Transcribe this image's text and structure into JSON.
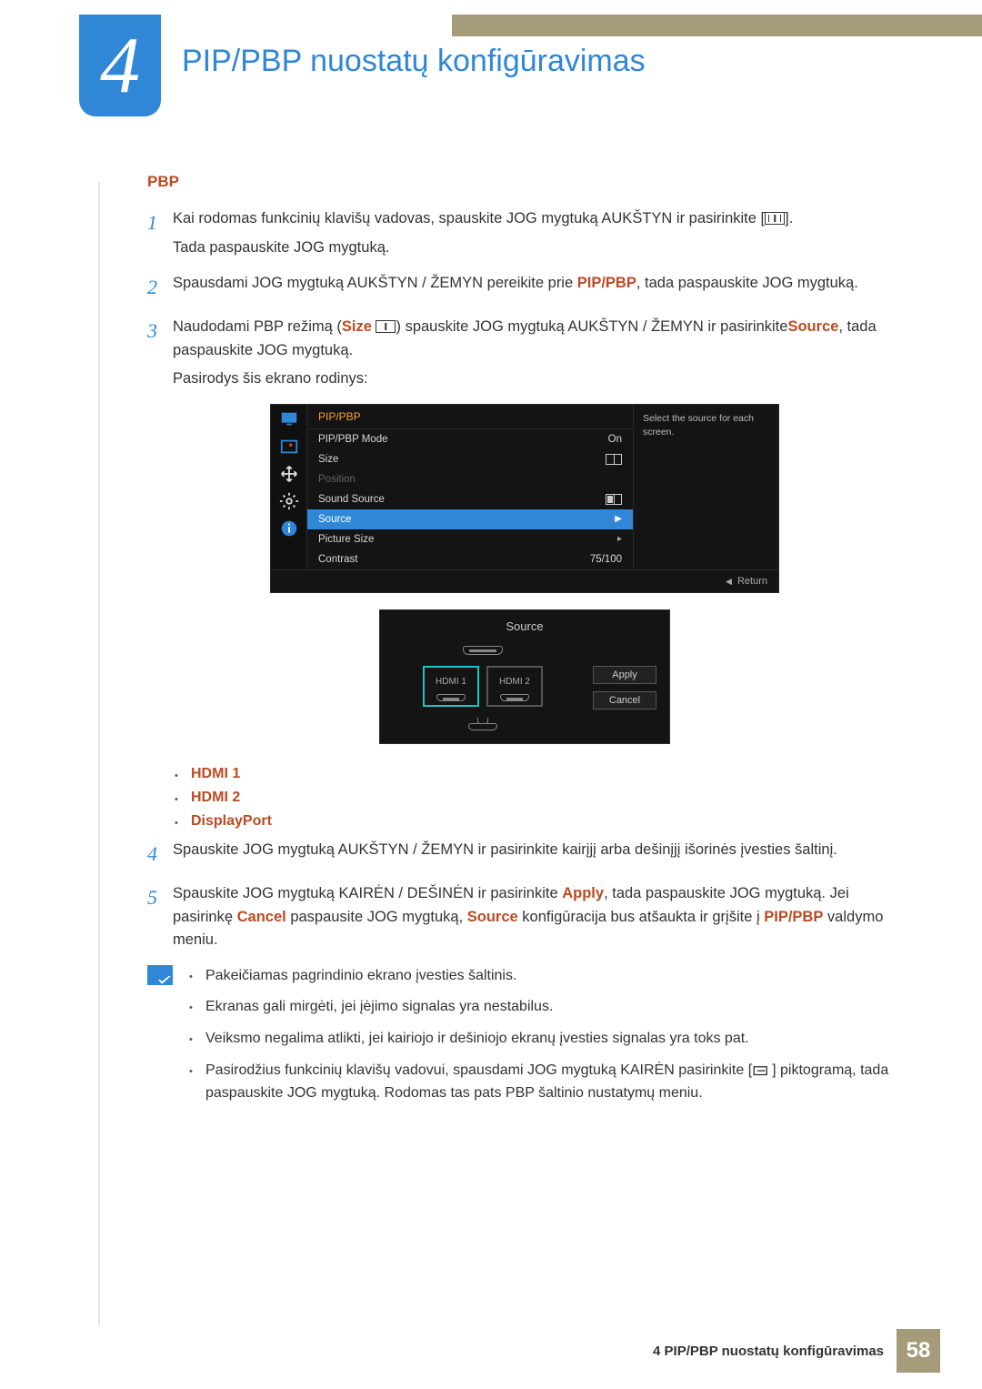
{
  "chapter": {
    "number": "4",
    "title": "PIP/PBP nuostatų konfigūravimas"
  },
  "section_label": "PBP",
  "steps": {
    "s1": {
      "n": "1",
      "a": "Kai rodomas funkcinių klavišų vadovas, spauskite JOG mygtuką AUKŠTYN ir pasirinkite [",
      "b": "].",
      "c": "Tada paspauskite JOG mygtuką."
    },
    "s2": {
      "n": "2",
      "a": "Spausdami JOG mygtuką AUKŠTYN / ŽEMYN pereikite prie ",
      "kw": "PIP/PBP",
      "b": ", tada paspauskite JOG mygtuką."
    },
    "s3": {
      "n": "3",
      "a": "Naudodami PBP režimą (",
      "kw1": "Size",
      "b": ") spauskite JOG mygtuką AUKŠTYN / ŽEMYN ir pasirinkite",
      "kw2": "Source",
      "c": ", tada paspauskite JOG mygtuką.",
      "d": "Pasirodys šis ekrano rodinys:"
    },
    "s4": {
      "n": "4",
      "a": "Spauskite JOG mygtuką AUKŠTYN / ŽEMYN ir pasirinkite kairįjį arba dešinįjį išorinės įvesties šaltinį."
    },
    "s5": {
      "n": "5",
      "a": "Spauskite JOG mygtuką KAIRĖN / DEŠINĖN ir pasirinkite ",
      "kw1": "Apply",
      "b": ", tada paspauskite JOG mygtuką. Jei pasirinkę ",
      "kw2": "Cancel",
      "c": " paspausite JOG mygtuką, ",
      "kw3": "Source",
      "d": " konfigūracija bus atšaukta ir grįšite į ",
      "kw4": "PIP/PBP",
      "e": " valdymo meniu."
    }
  },
  "osd": {
    "header": "PIP/PBP",
    "help": "Select the source for each screen.",
    "rows": {
      "mode": {
        "label": "PIP/PBP Mode",
        "value": "On"
      },
      "size": {
        "label": "Size"
      },
      "position": {
        "label": "Position"
      },
      "sound": {
        "label": "Sound Source"
      },
      "source": {
        "label": "Source"
      },
      "psize": {
        "label": "Picture Size"
      },
      "contrast": {
        "label": "Contrast",
        "value": "75/100"
      }
    },
    "return": "Return"
  },
  "src": {
    "title": "Source",
    "hdmi1": "HDMI  1",
    "hdmi2": "HDMI  2",
    "apply": "Apply",
    "cancel": "Cancel"
  },
  "redlist": {
    "a": "HDMI 1",
    "b": "HDMI 2",
    "c": "DisplayPort"
  },
  "notes": {
    "a": "Pakeičiamas pagrindinio ekrano įvesties šaltinis.",
    "b": "Ekranas gali mirgėti, jei įėjimo signalas yra nestabilus.",
    "c": "Veiksmo negalima atlikti, jei kairiojo ir dešiniojo ekranų įvesties signalas yra toks pat.",
    "d1": "Pasirodžius funkcinių klavišų vadovui, spausdami JOG mygtuką KAIRĖN pasirinkite [",
    "d2": "] piktogramą, tada paspauskite JOG mygtuką. Rodomas tas pats PBP šaltinio nustatymų meniu."
  },
  "footer": {
    "text": "4 PIP/PBP nuostatų konfigūravimas",
    "page": "58"
  }
}
